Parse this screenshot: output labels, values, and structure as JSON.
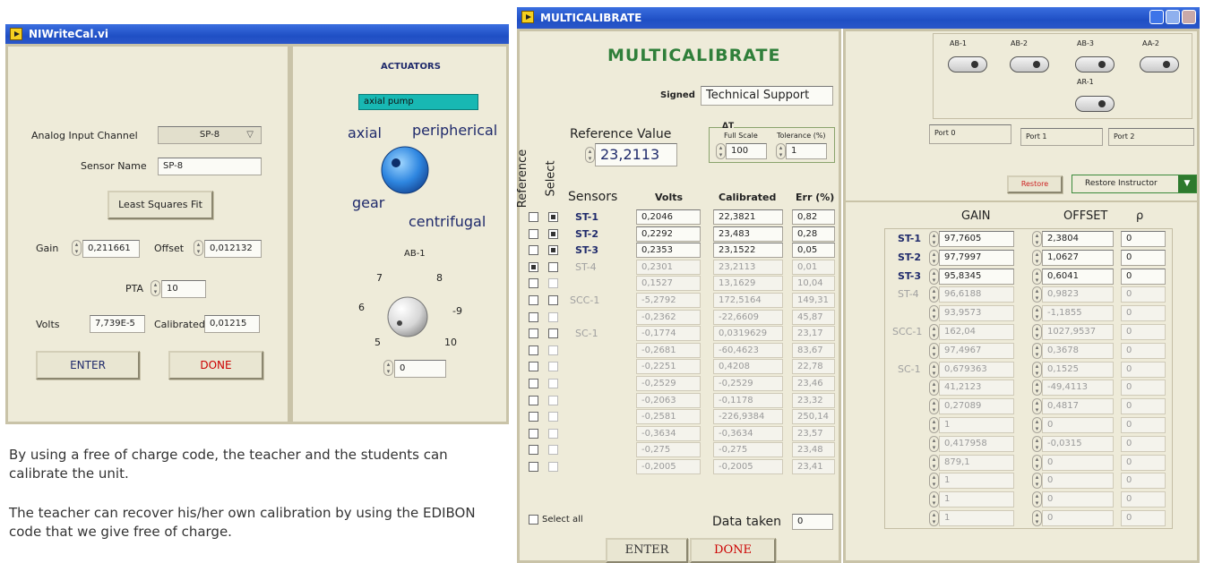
{
  "left_window": {
    "title": "NIWriteCal.vi",
    "analog_input_label": "Analog Input Channel",
    "analog_input_value": "SP-8",
    "sensor_name_label": "Sensor Name",
    "sensor_name_value": "SP-8",
    "least_squares_button": "Least Squares Fit",
    "gain_label": "Gain",
    "gain_value": "0,211661",
    "offset_label": "Offset",
    "offset_value": "0,012132",
    "pta_label": "PTA",
    "pta_value": "10",
    "volts_label": "Volts",
    "volts_value": "7,739E-5",
    "calibrated_label": "Calibrated",
    "calibrated_value": "0,01215",
    "enter_button": "ENTER",
    "done_button": "DONE",
    "actuators_title": "ACTUATORS",
    "actuator_selected": "axial pump",
    "knob_labels": {
      "axial": "axial",
      "peripherical": "peripherical",
      "gear": "gear",
      "centrifugal": "centrifugal"
    },
    "ab1_label": "AB-1",
    "dial_ticks": [
      "5",
      "6",
      "7",
      "8",
      "-9",
      "10"
    ],
    "dial_value": "0"
  },
  "caption": {
    "p1": "By using a free of charge code, the teacher and the students can calibrate the unit.",
    "p2": "The teacher can recover his/her own calibration by using the EDIBON code that we give free of charge."
  },
  "right_window": {
    "title": "MULTICALIBRATE",
    "heading": "MULTICALIBRATE",
    "signed_label": "Signed",
    "signed_value": "Technical Support",
    "reference_value_label": "Reference Value",
    "reference_value": "23,2113",
    "at_label": "ΔT",
    "full_scale_label": "Full Scale",
    "full_scale_value": "100",
    "tolerance_label": "Tolerance (%)",
    "tolerance_value": "1",
    "vertical_reference": "Reference",
    "vertical_select": "Select",
    "columns": {
      "sensors": "Sensors",
      "volts": "Volts",
      "calibrated": "Calibrated",
      "err": "Err (%)"
    },
    "rows": [
      {
        "ref": false,
        "sel": true,
        "name": "ST-1",
        "volts": "0,2046",
        "cal": "22,3821",
        "err": "0,82",
        "active": true
      },
      {
        "ref": false,
        "sel": true,
        "name": "ST-2",
        "volts": "0,2292",
        "cal": "23,483",
        "err": "0,28",
        "active": true
      },
      {
        "ref": false,
        "sel": true,
        "name": "ST-3",
        "volts": "0,2353",
        "cal": "23,1522",
        "err": "0,05",
        "active": true
      },
      {
        "ref": true,
        "sel": false,
        "name": "ST-4",
        "volts": "0,2301",
        "cal": "23,2113",
        "err": "0,01",
        "active": false
      },
      {
        "ref": false,
        "sel": false,
        "name": "",
        "volts": "0,1527",
        "cal": "13,1629",
        "err": "10,04",
        "active": false
      },
      {
        "ref": false,
        "sel": false,
        "name": "SCC-1",
        "volts": "-5,2792",
        "cal": "172,5164",
        "err": "149,31",
        "active": false
      },
      {
        "ref": false,
        "sel": false,
        "name": "",
        "volts": "-0,2362",
        "cal": "-22,6609",
        "err": "45,87",
        "active": false
      },
      {
        "ref": false,
        "sel": false,
        "name": "SC-1",
        "volts": "-0,1774",
        "cal": "0,0319629",
        "err": "23,17",
        "active": false
      },
      {
        "ref": false,
        "sel": false,
        "name": "",
        "volts": "-0,2681",
        "cal": "-60,4623",
        "err": "83,67",
        "active": false
      },
      {
        "ref": false,
        "sel": false,
        "name": "",
        "volts": "-0,2251",
        "cal": "0,4208",
        "err": "22,78",
        "active": false
      },
      {
        "ref": false,
        "sel": false,
        "name": "",
        "volts": "-0,2529",
        "cal": "-0,2529",
        "err": "23,46",
        "active": false
      },
      {
        "ref": false,
        "sel": false,
        "name": "",
        "volts": "-0,2063",
        "cal": "-0,1178",
        "err": "23,32",
        "active": false
      },
      {
        "ref": false,
        "sel": false,
        "name": "",
        "volts": "-0,2581",
        "cal": "-226,9384",
        "err": "250,14",
        "active": false
      },
      {
        "ref": false,
        "sel": false,
        "name": "",
        "volts": "-0,3634",
        "cal": "-0,3634",
        "err": "23,57",
        "active": false
      },
      {
        "ref": false,
        "sel": false,
        "name": "",
        "volts": "-0,275",
        "cal": "-0,275",
        "err": "23,48",
        "active": false
      },
      {
        "ref": false,
        "sel": false,
        "name": "",
        "volts": "-0,2005",
        "cal": "-0,2005",
        "err": "23,41",
        "active": false
      }
    ],
    "select_all_label": "Select all",
    "data_taken_label": "Data taken",
    "data_taken_value": "0",
    "enter_button": "ENTER",
    "done_button": "DONE",
    "toggles": [
      "AB-1",
      "AB-2",
      "AB-3",
      "AA-2",
      "AR-1"
    ],
    "ports": [
      "Port 0",
      "Port 1",
      "Port 2"
    ],
    "restore_button": "Restore",
    "restore_instructor": "Restore Instructor",
    "gain_header": "GAIN",
    "offset_header": "OFFSET",
    "rho_header": "ρ",
    "gain_rows": [
      {
        "name": "ST-1",
        "gain": "97,7605",
        "offset": "2,3804",
        "rho": "0",
        "active": true
      },
      {
        "name": "ST-2",
        "gain": "97,7997",
        "offset": "1,0627",
        "rho": "0",
        "active": true
      },
      {
        "name": "ST-3",
        "gain": "95,8345",
        "offset": "0,6041",
        "rho": "0",
        "active": true
      },
      {
        "name": "ST-4",
        "gain": "96,6188",
        "offset": "0,9823",
        "rho": "0",
        "active": false
      },
      {
        "name": "",
        "gain": "93,9573",
        "offset": "-1,1855",
        "rho": "0",
        "active": false
      },
      {
        "name": "SCC-1",
        "gain": "162,04",
        "offset": "1027,9537",
        "rho": "0",
        "active": false
      },
      {
        "name": "",
        "gain": "97,4967",
        "offset": "0,3678",
        "rho": "0",
        "active": false
      },
      {
        "name": "SC-1",
        "gain": "0,679363",
        "offset": "0,1525",
        "rho": "0",
        "active": false
      },
      {
        "name": "",
        "gain": "41,2123",
        "offset": "-49,4113",
        "rho": "0",
        "active": false
      },
      {
        "name": "",
        "gain": "0,27089",
        "offset": "0,4817",
        "rho": "0",
        "active": false
      },
      {
        "name": "",
        "gain": "1",
        "offset": "0",
        "rho": "0",
        "active": false
      },
      {
        "name": "",
        "gain": "0,417958",
        "offset": "-0,0315",
        "rho": "0",
        "active": false
      },
      {
        "name": "",
        "gain": "879,1",
        "offset": "0",
        "rho": "0",
        "active": false
      },
      {
        "name": "",
        "gain": "1",
        "offset": "0",
        "rho": "0",
        "active": false
      },
      {
        "name": "",
        "gain": "1",
        "offset": "0",
        "rho": "0",
        "active": false
      },
      {
        "name": "",
        "gain": "1",
        "offset": "0",
        "rho": "0",
        "active": false
      }
    ]
  }
}
